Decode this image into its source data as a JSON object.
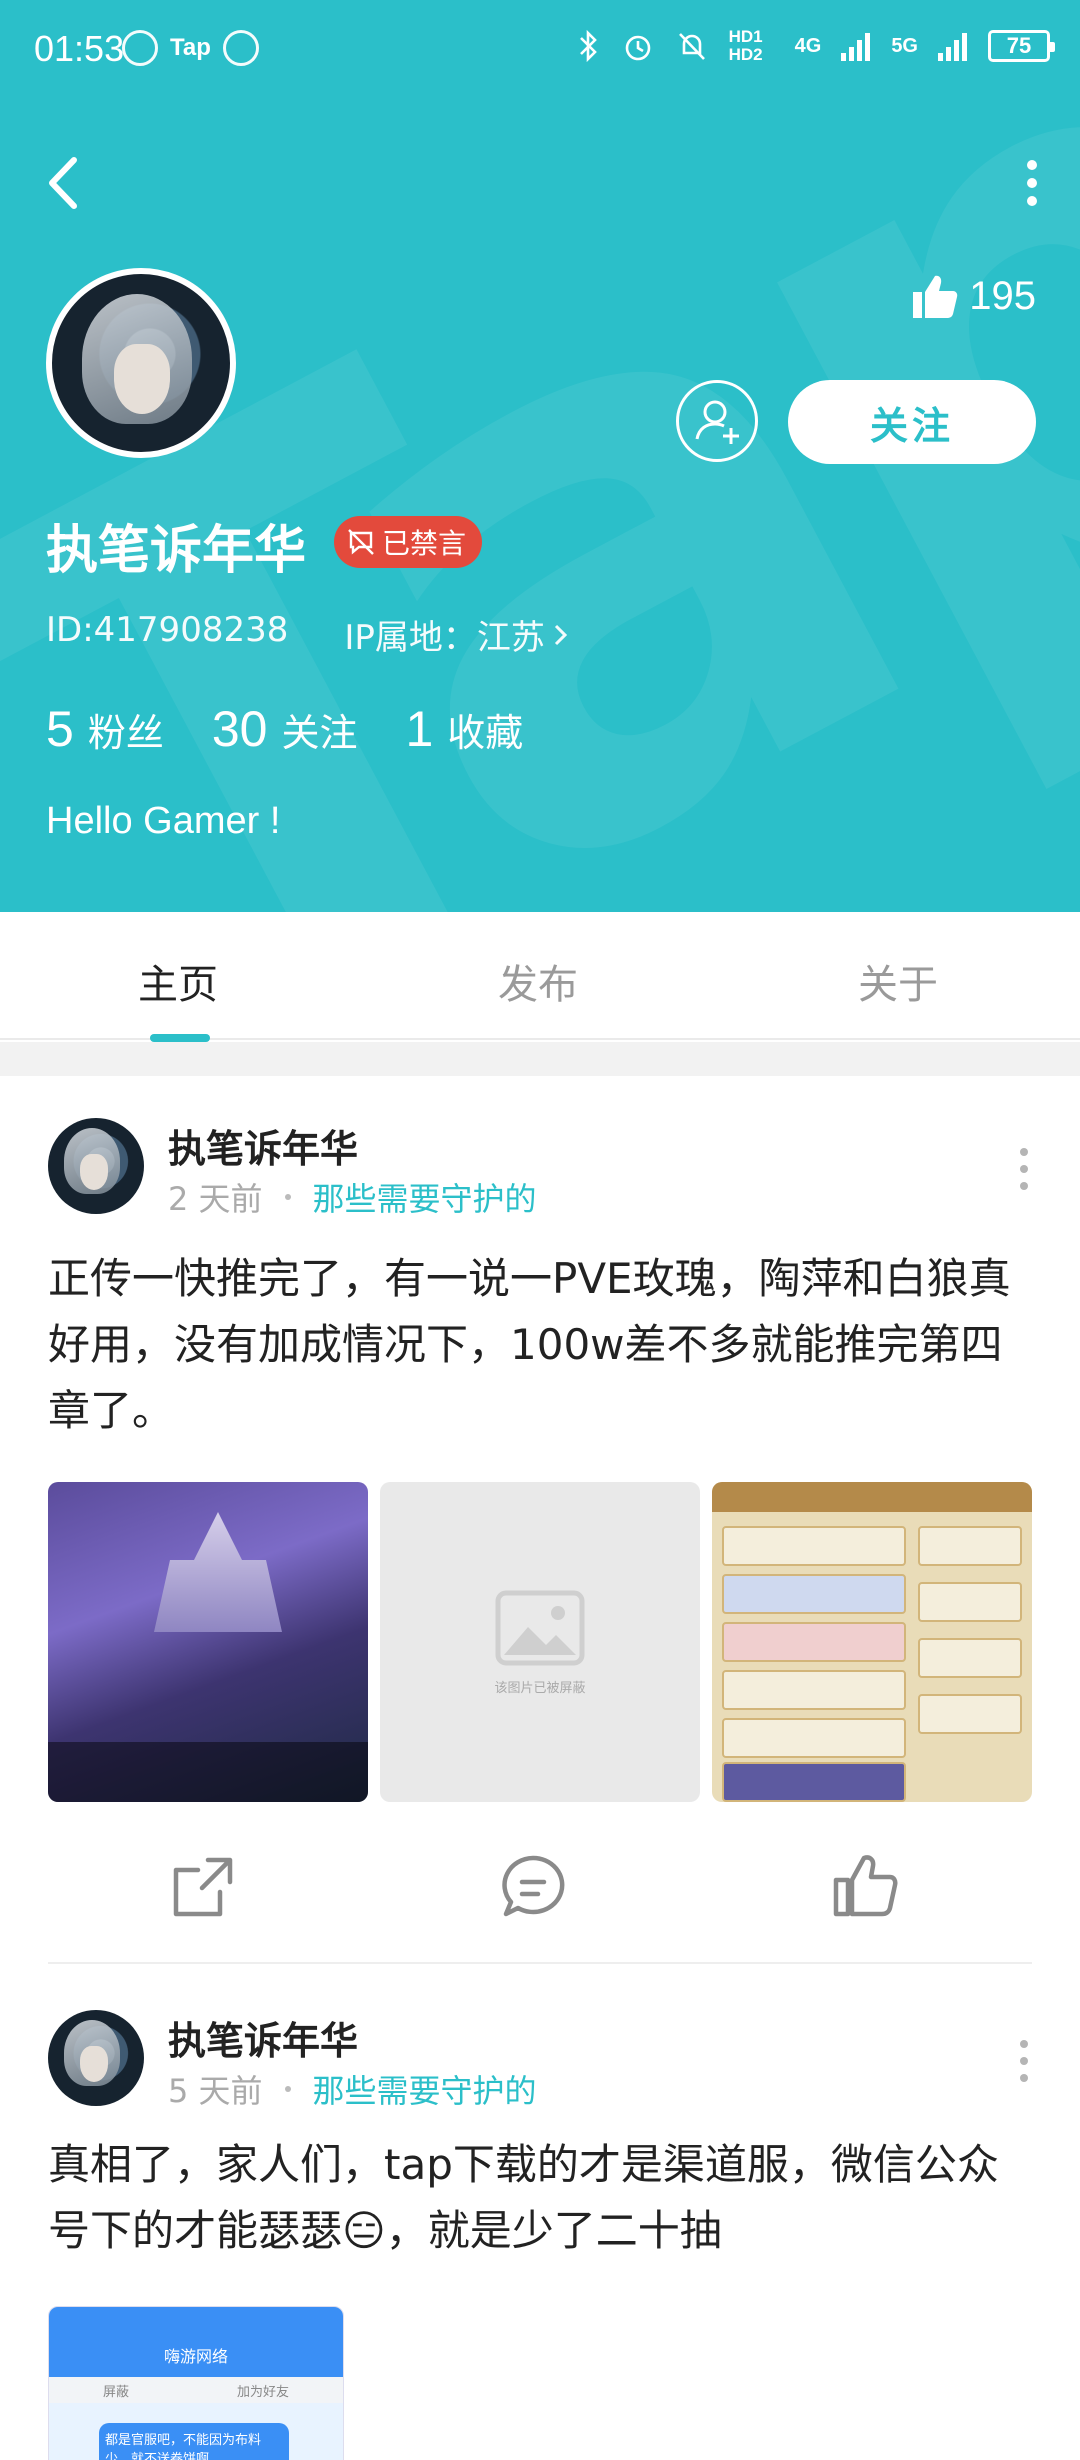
{
  "status_bar": {
    "time": "01:53",
    "tap_label": "Tap",
    "hd_label": "HD1 HD2",
    "net_4g": "4G",
    "net_5g": "5G",
    "battery": "75"
  },
  "profile": {
    "username": "执笔诉年华",
    "banned_badge": "已禁言",
    "id_text": "ID:417908238",
    "ip_text": "IP属地：江苏",
    "likes": "195",
    "follow_label": "关注",
    "stats": [
      {
        "num": "5",
        "label": "粉丝"
      },
      {
        "num": "30",
        "label": "关注"
      },
      {
        "num": "1",
        "label": "收藏"
      }
    ],
    "bio": "Hello Gamer !"
  },
  "tabs": [
    {
      "label": "主页",
      "active": true
    },
    {
      "label": "发布",
      "active": false
    },
    {
      "label": "关于",
      "active": false
    }
  ],
  "posts": [
    {
      "author": "执笔诉年华",
      "time": "2 天前",
      "topic": "那些需要守护的",
      "text": "正传一快推完了，有一说一PVE玫瑰，陶萍和白狼真好用，没有加成情况下，100w差不多就能推完第四章了。",
      "image_placeholder": "该图片已被屏蔽"
    },
    {
      "author": "执笔诉年华",
      "time": "5 天前",
      "topic": "那些需要守护的",
      "text": "真相了，家人们，tap下载的才是渠道服，微信公众号下的才能瑟瑟😑，就是少了二十抽",
      "image_header": "嗨游网络",
      "image_tab_left": "屏蔽",
      "image_tab_right": "加为好友",
      "image_bubble": "都是官服吧，不能因为布料少，就不送卷饼啊"
    }
  ],
  "colors": {
    "brand": "#2bbfc9",
    "banned": "#e34a3c"
  }
}
